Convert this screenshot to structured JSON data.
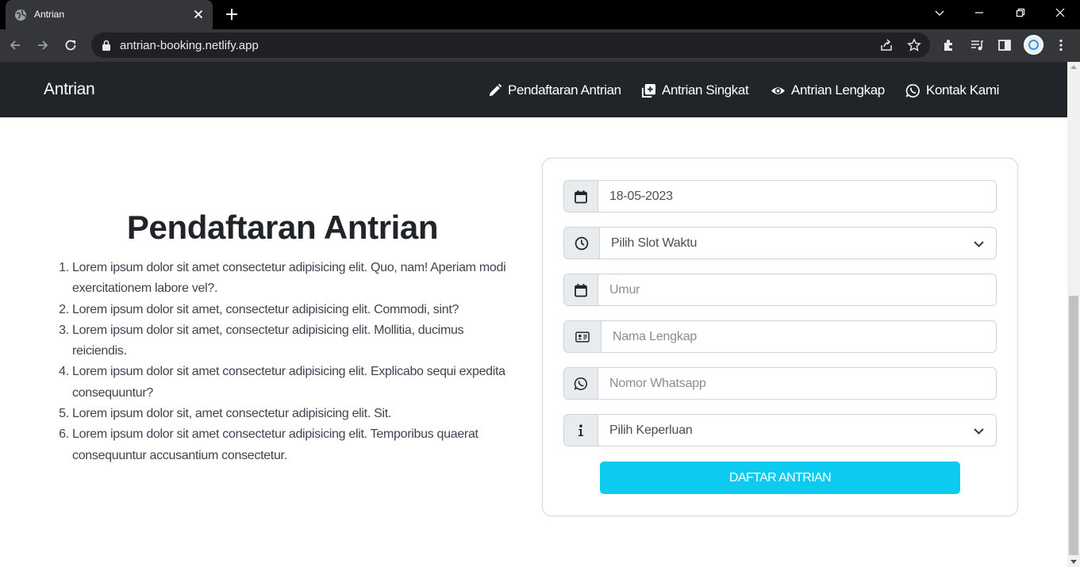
{
  "browser": {
    "tab_title": "Antrian",
    "url": "antrian-booking.netlify.app"
  },
  "navbar": {
    "brand": "Antrian",
    "links": [
      {
        "label": "Pendaftaran Antrian",
        "icon": "pencil-icon"
      },
      {
        "label": "Antrian Singkat",
        "icon": "plus-square-icon"
      },
      {
        "label": "Antrian Lengkap",
        "icon": "eye-icon"
      },
      {
        "label": "Kontak Kami",
        "icon": "whatsapp-icon"
      }
    ]
  },
  "main": {
    "heading": "Pendaftaran Antrian",
    "list": [
      "Lorem ipsum dolor sit amet consectetur adipisicing elit. Quo, nam! Aperiam modi exercitationem labore vel?.",
      "Lorem ipsum dolor sit amet, consectetur adipisicing elit. Commodi, sint?",
      "Lorem ipsum dolor sit amet, consectetur adipisicing elit. Mollitia, ducimus reiciendis.",
      "Lorem ipsum dolor sit amet consectetur adipisicing elit. Explicabo sequi expedita consequuntur?",
      "Lorem ipsum dolor sit, amet consectetur adipisicing elit. Sit.",
      "Lorem ipsum dolor sit amet consectetur adipisicing elit. Temporibus quaerat consequuntur accusantium consectetur."
    ]
  },
  "form": {
    "date_value": "18-05-2023",
    "slot_select": "Pilih Slot Waktu",
    "age_placeholder": "Umur",
    "name_placeholder": "Nama Lengkap",
    "whatsapp_placeholder": "Nomor Whatsapp",
    "purpose_select": "Pilih Keperluan",
    "submit_label": "DAFTAR ANTRIAN"
  },
  "colors": {
    "navbar_bg": "#212529",
    "button_bg": "#0dcaf0",
    "addon_bg": "#e9ecef",
    "border": "#ced4da"
  }
}
